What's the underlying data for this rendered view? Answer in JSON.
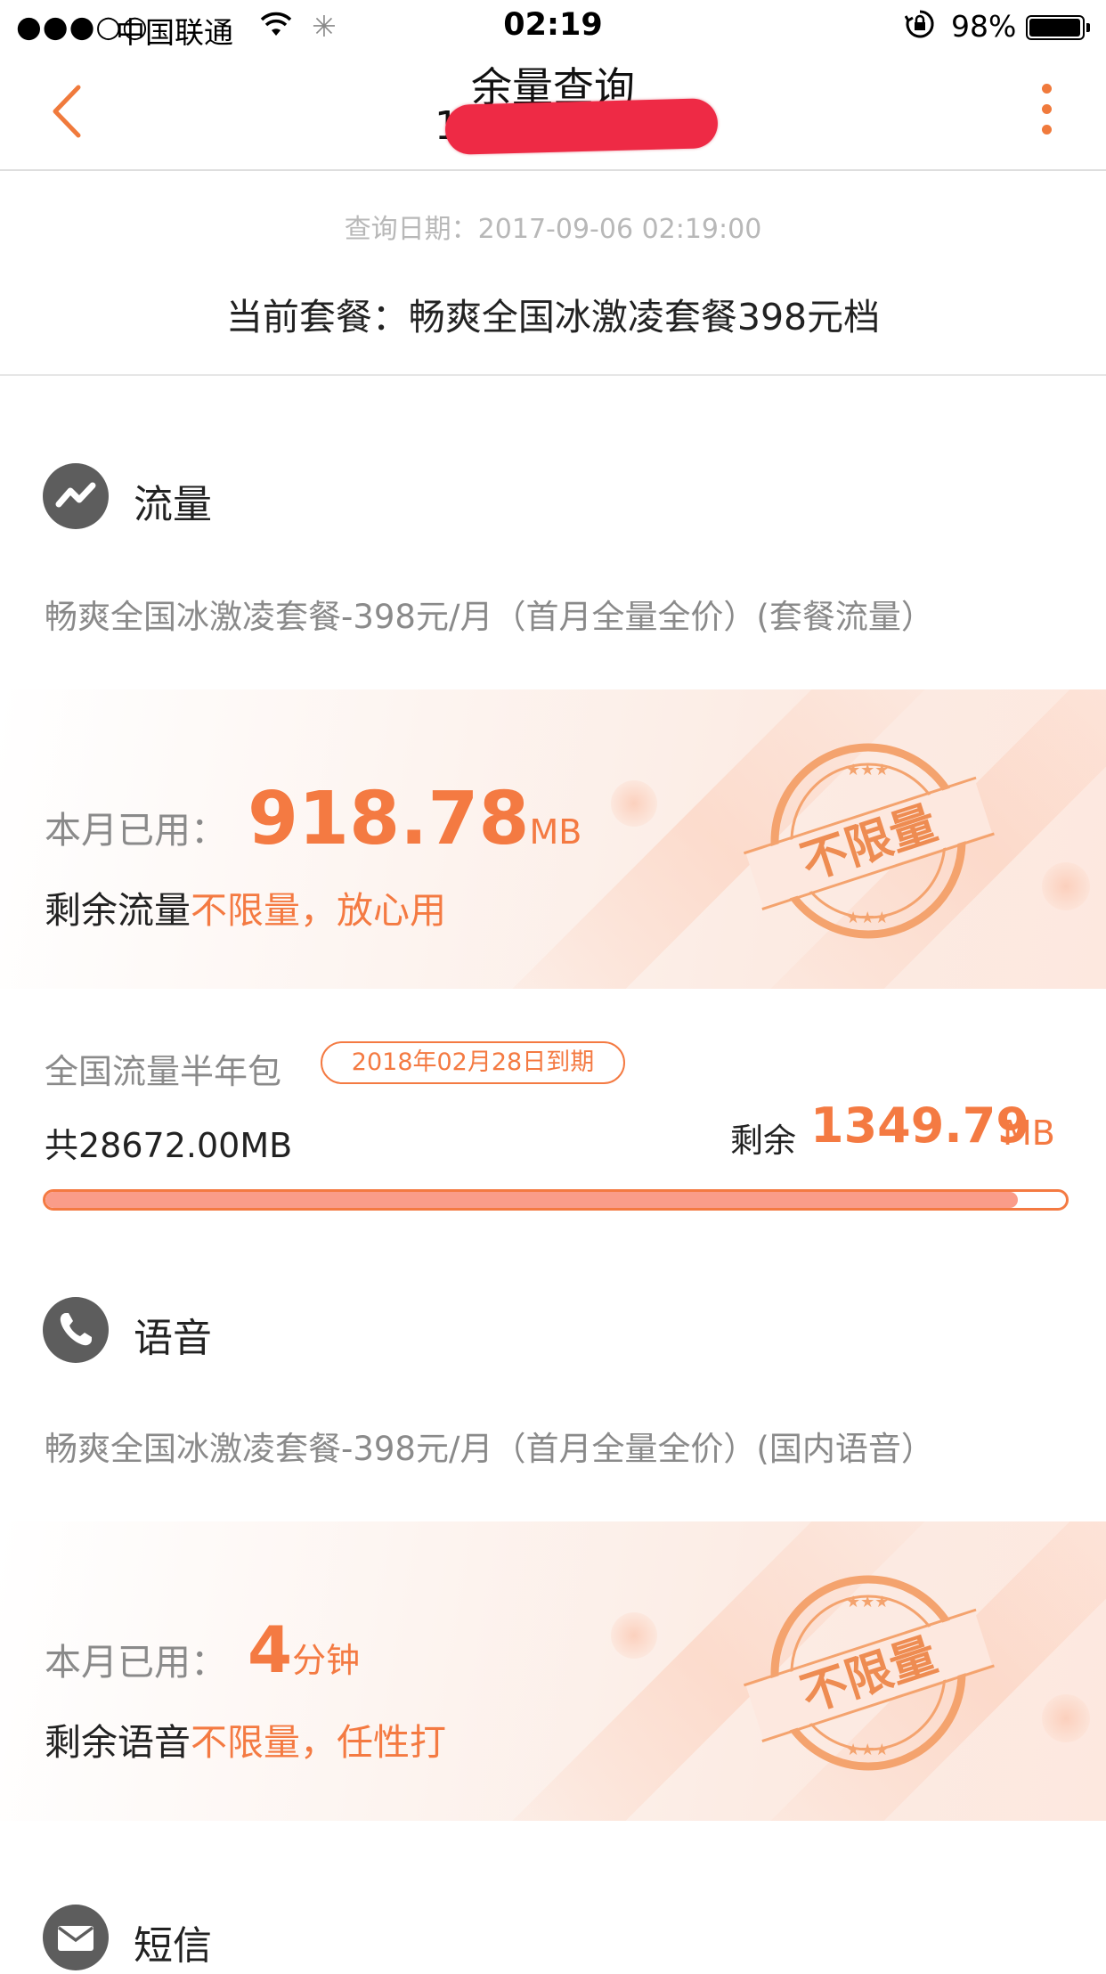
{
  "status_bar": {
    "signal": "●●●○○",
    "carrier": "中国联通",
    "time": "02:19",
    "battery": "98%",
    "battery_level": 0.98
  },
  "nav": {
    "title": "余量查询",
    "subtitle_visible_char": "1"
  },
  "query_date": "查询日期：2017-09-06 02:19:00",
  "current_plan": "当前套餐：畅爽全国冰激凌套餐398元档",
  "data_section": {
    "title": "流量",
    "icon": "trend-icon",
    "plan_desc": "畅爽全国冰激凌套餐-398元/月（首月全量全价）(套餐流量）",
    "used_label": "本月已用：",
    "used_value": "918.78",
    "used_unit": "MB",
    "remain_prefix": "剩余流量",
    "remain_text": "不限量，放心用",
    "stamp_text": "不限量"
  },
  "half_year_pack": {
    "name": "全国流量半年包",
    "expiry": "2018年02月28日到期",
    "total": "共28672.00MB",
    "remain_label": "剩余",
    "remain_value": "1349.79",
    "remain_unit": "MB",
    "used_fraction": 0.953
  },
  "voice_section": {
    "title": "语音",
    "icon": "phone-icon",
    "plan_desc": "畅爽全国冰激凌套餐-398元/月（首月全量全价）(国内语音）",
    "used_label": "本月已用：",
    "used_value": "4",
    "used_unit": "分钟",
    "remain_prefix": "剩余语音",
    "remain_text": "不限量，任性打",
    "stamp_text": "不限量"
  },
  "sms_section": {
    "title": "短信",
    "icon": "envelope-icon"
  },
  "colors": {
    "accent": "#f47a42",
    "progress_fill": "#fa9c89",
    "redaction": "#ee2a45"
  }
}
